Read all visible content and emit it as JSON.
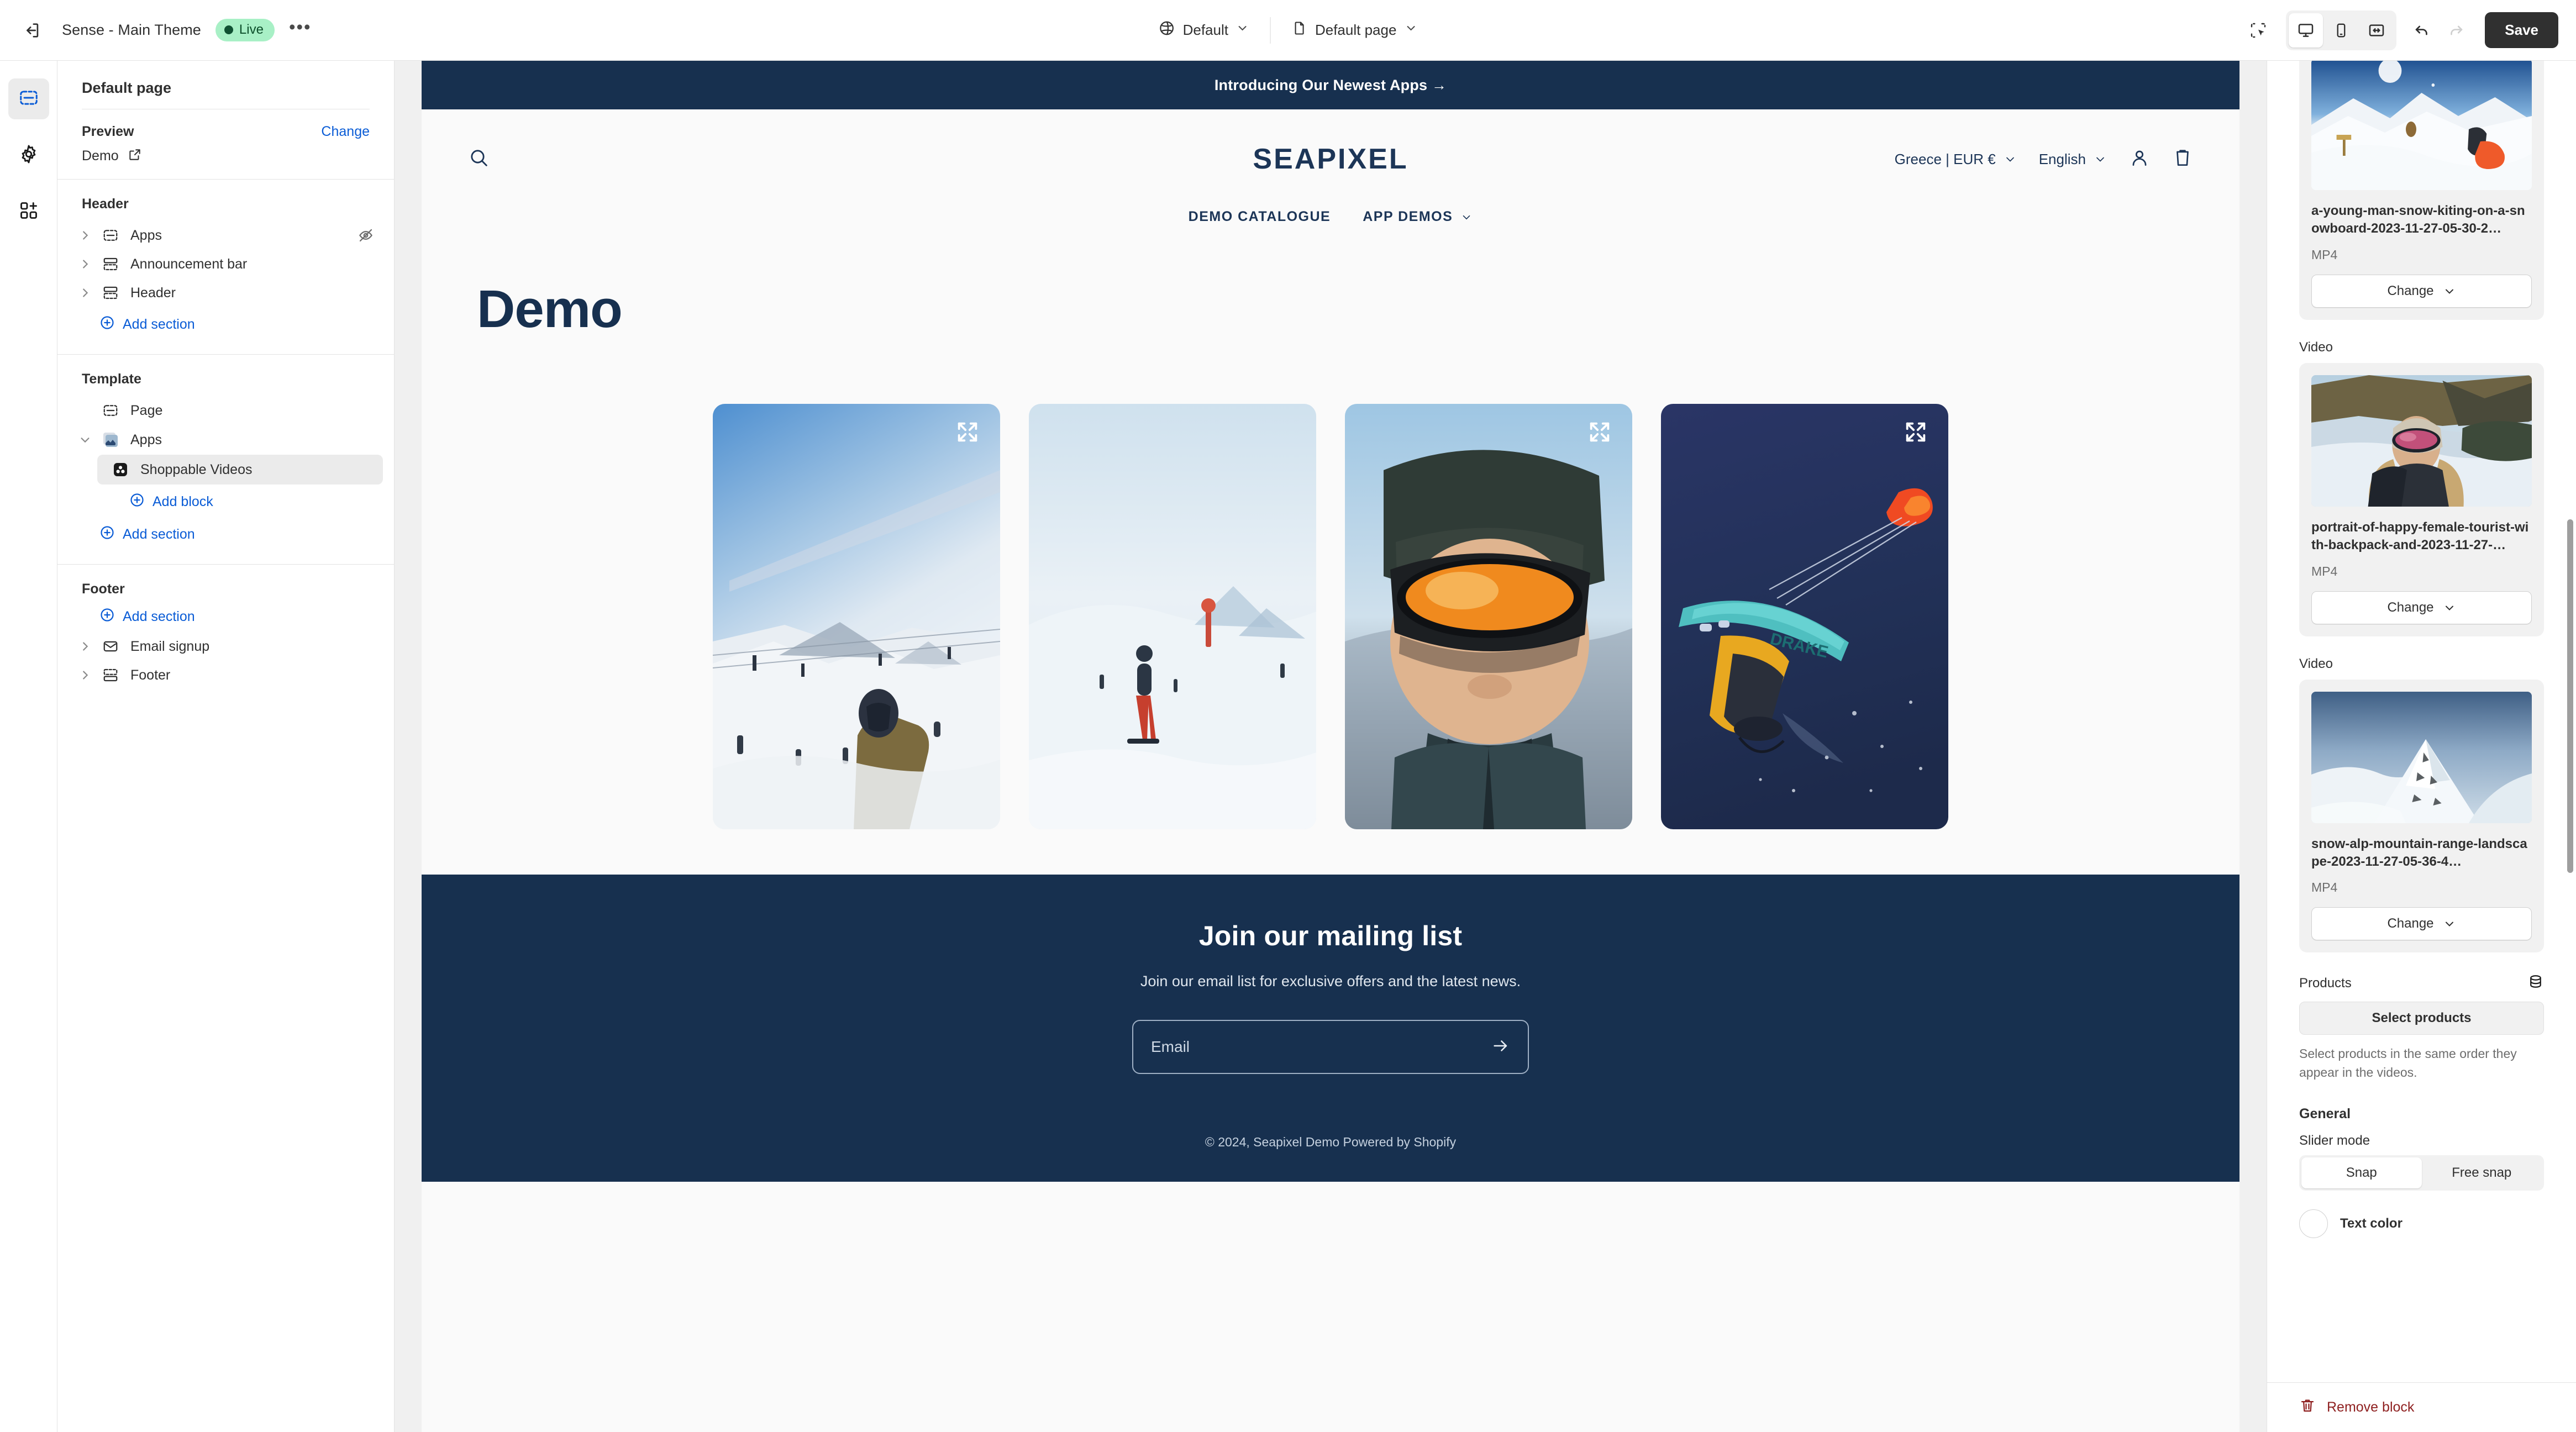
{
  "topbar": {
    "exit_icon": "exit-icon",
    "theme_name": "Sense - Main Theme",
    "status_badge": "Live",
    "more_label": "•••",
    "market_selector": {
      "icon": "globe-icon",
      "label": "Default"
    },
    "page_selector": {
      "icon": "page-icon",
      "label": "Default page"
    },
    "tools": {
      "inspector": "inspector-icon",
      "desktop": "desktop-icon",
      "mobile": "mobile-icon",
      "fullwidth": "fullwidth-icon",
      "undo": "undo-icon",
      "redo": "redo-icon"
    },
    "save_label": "Save"
  },
  "rail": {
    "items": [
      {
        "name": "sections-icon",
        "label": "Sections",
        "active": true
      },
      {
        "name": "gear-icon",
        "label": "Settings",
        "active": false
      },
      {
        "name": "apps-add-icon",
        "label": "App embeds",
        "active": false
      }
    ]
  },
  "sidebar": {
    "title": "Default page",
    "preview": {
      "label": "Preview",
      "change_label": "Change",
      "value": "Demo",
      "external_icon": "external-link-icon"
    },
    "groups": [
      {
        "heading": "Header",
        "items": [
          {
            "label": "Apps",
            "icon": "app-block-icon",
            "caret": "chevron-right",
            "hidden_icon": "eye-off-icon"
          },
          {
            "label": "Announcement bar",
            "icon": "section-icon",
            "caret": "chevron-right"
          },
          {
            "label": "Header",
            "icon": "section-icon",
            "caret": "chevron-right"
          }
        ],
        "add_label": "Add section"
      },
      {
        "heading": "Template",
        "items": [
          {
            "label": "Page",
            "icon": "app-block-icon"
          },
          {
            "label": "Apps",
            "icon": "app-thumb-icon",
            "caret": "chevron-down"
          }
        ],
        "children": [
          {
            "label": "Shoppable Videos",
            "icon": "shoppable-videos-icon",
            "selected": true
          }
        ],
        "add_block_label": "Add block",
        "add_label": "Add section"
      },
      {
        "heading": "Footer",
        "add_label": "Add section",
        "items": [
          {
            "label": "Email signup",
            "icon": "envelope-icon",
            "caret": "chevron-right"
          },
          {
            "label": "Footer",
            "icon": "footer-icon",
            "caret": "chevron-right"
          }
        ]
      }
    ]
  },
  "preview": {
    "announcement": "Introducing Our Newest Apps  →",
    "search_icon": "search-icon",
    "logo": "SEAPIXEL",
    "country_currency": "Greece | EUR €",
    "language": "English",
    "account_icon": "account-icon",
    "cart_icon": "cart-icon",
    "nav": [
      {
        "label": "DEMO CATALOGUE",
        "has_caret": false
      },
      {
        "label": "APP DEMOS",
        "has_caret": true
      }
    ],
    "page_title": "Demo",
    "videos": [
      {
        "alt": "snowboarder riding powder on mountain",
        "expand_icon": "expand-icon"
      },
      {
        "alt": "skier on snowy slope with lift",
        "expand_icon": "expand-icon"
      },
      {
        "alt": "close-up man with helmet and orange goggles",
        "expand_icon": "expand-icon"
      },
      {
        "alt": "snow kiter airborne with orange kite",
        "expand_icon": "expand-icon"
      }
    ],
    "footer": {
      "heading": "Join our mailing list",
      "subtext": "Join our email list for exclusive offers and the latest news.",
      "email_placeholder": "Email",
      "email_value": "",
      "submit_icon": "arrow-right-icon",
      "copyright": "© 2024, Seapixel Demo Powered by Shopify"
    },
    "colors": {
      "navy": "#17304f",
      "page_bg": "#fafafa"
    }
  },
  "right_panel": {
    "media": [
      {
        "name": "a-young-man-snow-kiting-on-a-snowboard-2023-11-27-05-30-2…",
        "type": "MP4",
        "change_label": "Change",
        "section_label": null
      },
      {
        "section_label": "Video",
        "name": "portrait-of-happy-female-tourist-with-backpack-and-2023-11-27-…",
        "type": "MP4",
        "change_label": "Change"
      },
      {
        "section_label": "Video",
        "name": "snow-alp-mountain-range-landscape-2023-11-27-05-36-4…",
        "type": "MP4",
        "change_label": "Change"
      }
    ],
    "products": {
      "title": "Products",
      "db_icon": "database-icon",
      "select_label": "Select products",
      "help": "Select products in the same order they appear in the videos."
    },
    "general": {
      "title": "General",
      "slider_mode_label": "Slider mode",
      "slider_options": [
        "Snap",
        "Free snap"
      ],
      "slider_selected": "Snap",
      "text_color_label": "Text color"
    },
    "remove_label": "Remove block",
    "remove_icon": "trash-icon"
  }
}
